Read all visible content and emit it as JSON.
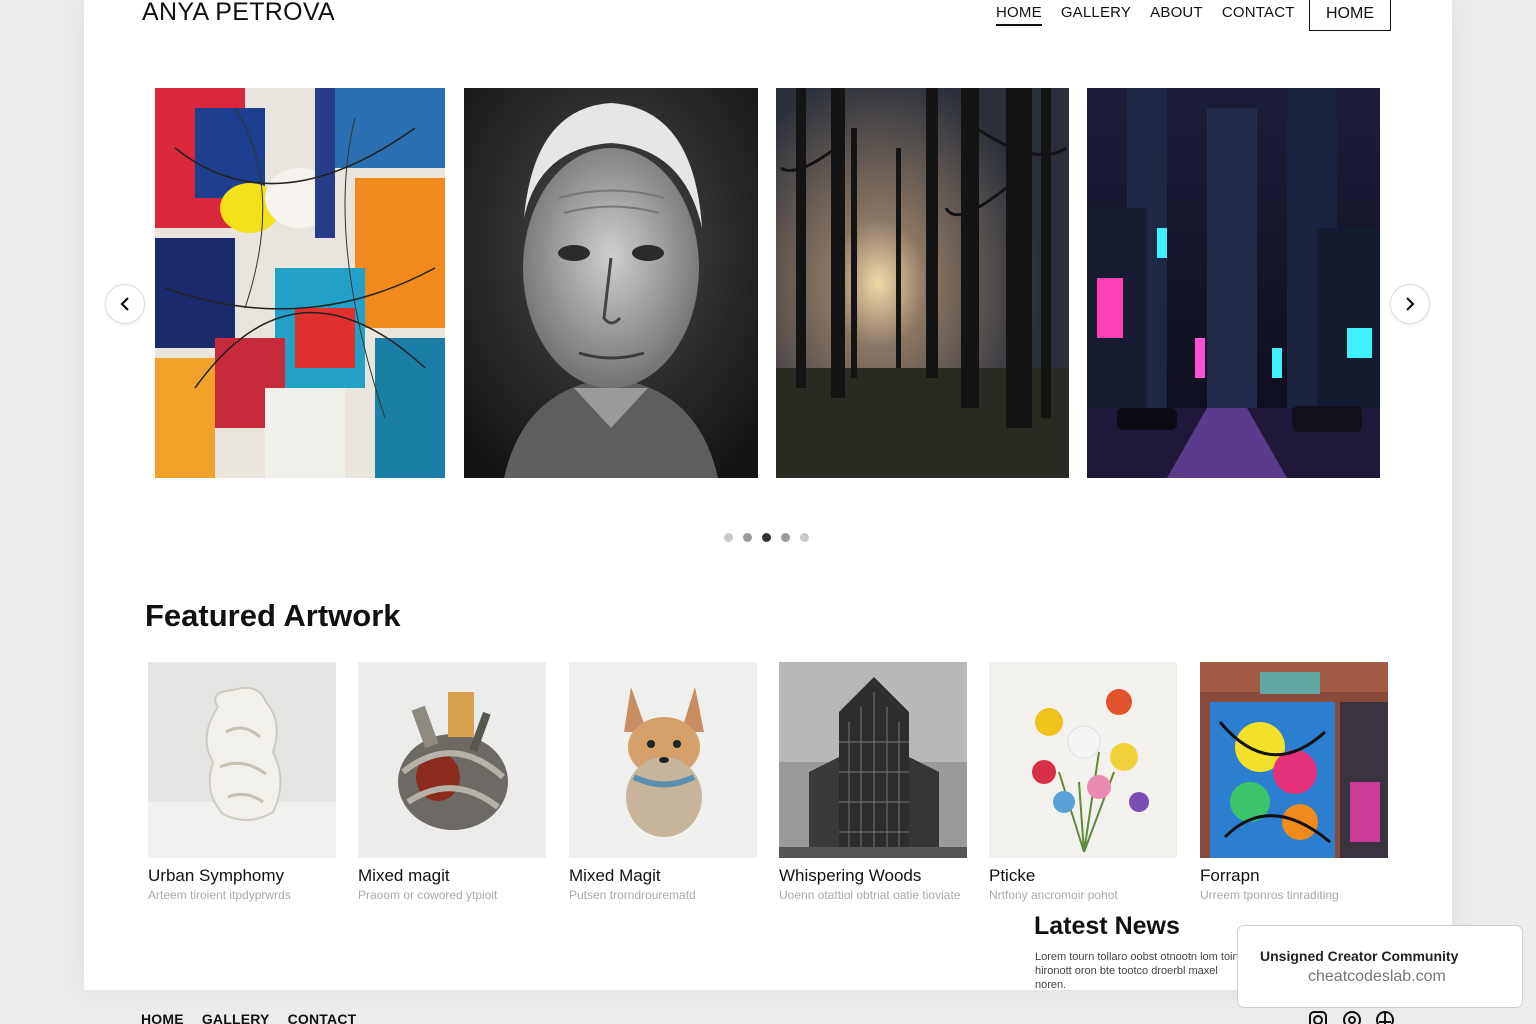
{
  "header": {
    "brand": "ANYA PETROVA",
    "nav": [
      "HOME",
      "GALLERY",
      "ABOUT",
      "CONTACT"
    ],
    "active_nav": "HOME",
    "button_label": "HOME"
  },
  "carousel": {
    "slides": [
      "abstract-painting",
      "elderly-man-portrait",
      "misty-forest",
      "neon-city-night"
    ],
    "dots_count": 5,
    "active_dot": 3
  },
  "featured": {
    "title": "Featured Artwork",
    "items": [
      {
        "title": "Urban Symphomy",
        "subtitle": "Arteem tiroient itpdyprwrds"
      },
      {
        "title": "Mixed magit",
        "subtitle": "Praoom or cowored ytpioit"
      },
      {
        "title": "Mixed Magit",
        "subtitle": "Putsen trorndrourematd"
      },
      {
        "title": "Whispering Woods",
        "subtitle": "Uoenn otattioi obtriat oatie tioviate"
      },
      {
        "title": "Pticke",
        "subtitle": "Nrtfony ancromoir pohot"
      },
      {
        "title": "Forrapn",
        "subtitle": "Urreem tponros tinraditing"
      }
    ]
  },
  "news": {
    "title": "Latest News",
    "text": "Lorem tourn tollaro oobst otnootn lom toinn hironott oron bte tootco droerbl maxel noren."
  },
  "badge": {
    "line1": "Unsigned Creator Community",
    "line2": "cheatcodeslab.com"
  },
  "footer": {
    "nav": [
      "HOME",
      "GALLERY",
      "CONTACT"
    ]
  },
  "colors": {
    "page_bg": "#ececec",
    "sheet_bg": "#ffffff",
    "text": "#111111",
    "muted": "#a9a9a9"
  }
}
